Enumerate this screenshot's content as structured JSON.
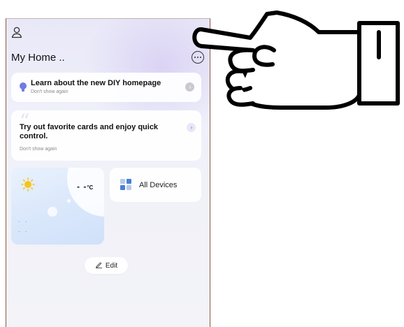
{
  "header": {
    "user_icon": "user-icon",
    "home_title": "My Home ..",
    "more_icon": "more-options-icon"
  },
  "banners": [
    {
      "title": "Learn about the new DIY homepage",
      "dismiss": "Don't show again",
      "icon": "lightbulb-icon"
    },
    {
      "title": "Try out favorite cards and enjoy quick control.",
      "dismiss": "Don't show again",
      "icon": "quote-icon"
    }
  ],
  "weather": {
    "icon": "sun-icon",
    "temperature": "- -",
    "unit": "°C",
    "line1": "- -",
    "line2": "- -"
  },
  "all_devices": {
    "label": "All Devices",
    "icon": "device-grid-icon"
  },
  "edit": {
    "label": "Edit",
    "icon": "edit-pencil-icon"
  },
  "overlay": {
    "icon": "pointing-hand-icon"
  },
  "colors": {
    "accent": "#7b86c9",
    "sun": "#f5c518",
    "grid_blue": "#4a7fd6",
    "grid_light": "#b7c9ec"
  }
}
